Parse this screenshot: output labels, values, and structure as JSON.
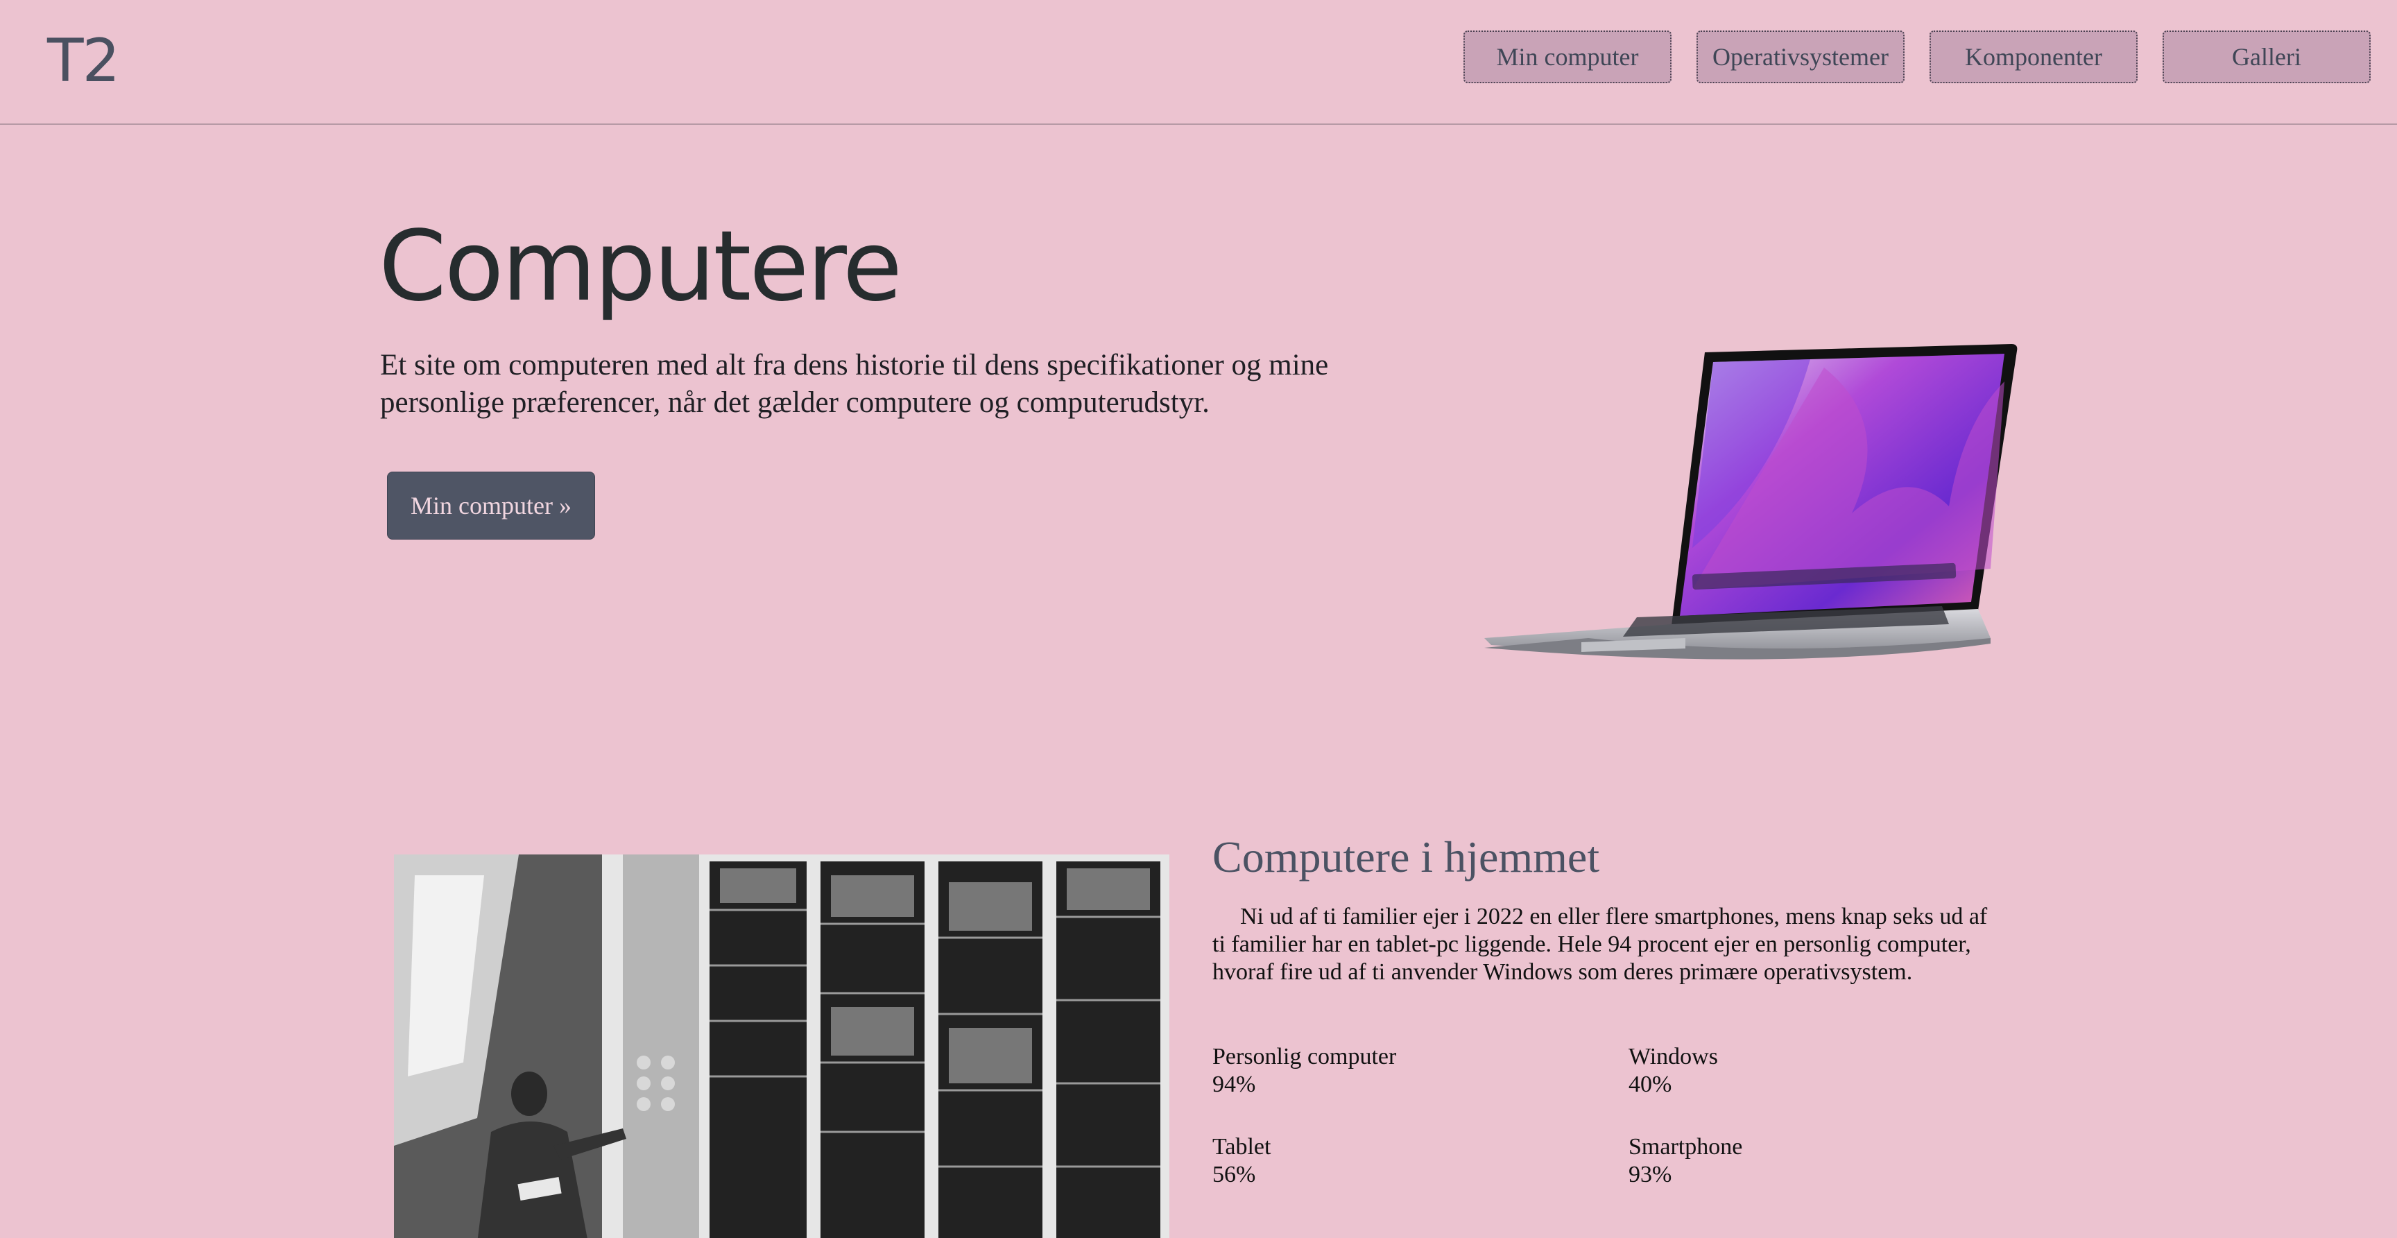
{
  "header": {
    "logo": "T2",
    "nav": [
      "Min computer",
      "Operativsystemer",
      "Komponenter",
      "Galleri"
    ]
  },
  "hero": {
    "title": "Computere",
    "text": "Et site om computeren med alt fra dens historie til dens specifikationer og mine personlige præferencer, når det gælder computere og computerudstyr.",
    "cta": "Min computer »"
  },
  "home_section": {
    "title": "Computere i hjemmet",
    "text": "Ni ud af ti familier ejer i 2022 en eller flere smartphones, mens knap seks ud af ti familier har en tablet-pc liggende. Hele 94 procent ejer en personlig computer, hvoraf fire ud af ti anvender Windows som deres primære operativsystem.",
    "stats": [
      {
        "label": "Personlig computer",
        "value": "94%"
      },
      {
        "label": "Windows",
        "value": "40%"
      },
      {
        "label": "Tablet",
        "value": "56%"
      },
      {
        "label": "Smartphone",
        "value": "93%"
      }
    ]
  },
  "colors": {
    "background": "#ecc3d0",
    "nav_button": "#c9a3b7",
    "cta_button": "#4f5565",
    "heading": "#262c2e"
  }
}
